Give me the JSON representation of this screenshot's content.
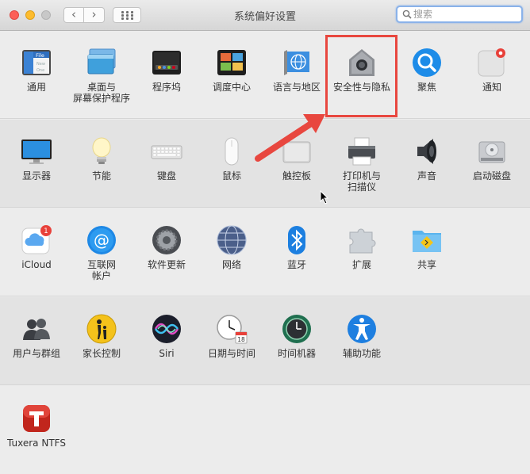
{
  "window": {
    "title": "系统偏好设置",
    "search_placeholder": "搜索"
  },
  "sections": [
    {
      "items": [
        {
          "id": "general",
          "label": "通用",
          "icon": "general-icon"
        },
        {
          "id": "desktop",
          "label": "桌面与\n屏幕保护程序",
          "icon": "desktop-screensaver-icon"
        },
        {
          "id": "dock",
          "label": "程序坞",
          "icon": "dock-icon"
        },
        {
          "id": "mission-control",
          "label": "调度中心",
          "icon": "mission-control-icon"
        },
        {
          "id": "language",
          "label": "语言与地区",
          "icon": "language-region-icon"
        },
        {
          "id": "security",
          "label": "安全性与隐私",
          "icon": "security-privacy-icon"
        },
        {
          "id": "spotlight",
          "label": "聚焦",
          "icon": "spotlight-icon"
        },
        {
          "id": "notifications",
          "label": "通知",
          "icon": "notifications-icon"
        }
      ]
    },
    {
      "items": [
        {
          "id": "displays",
          "label": "显示器",
          "icon": "displays-icon"
        },
        {
          "id": "energy",
          "label": "节能",
          "icon": "energy-saver-icon"
        },
        {
          "id": "keyboard",
          "label": "键盘",
          "icon": "keyboard-icon"
        },
        {
          "id": "mouse",
          "label": "鼠标",
          "icon": "mouse-icon"
        },
        {
          "id": "trackpad",
          "label": "触控板",
          "icon": "trackpad-icon"
        },
        {
          "id": "printers",
          "label": "打印机与\n扫描仪",
          "icon": "printer-icon"
        },
        {
          "id": "sound",
          "label": "声音",
          "icon": "sound-icon"
        },
        {
          "id": "startup-disk",
          "label": "启动磁盘",
          "icon": "startup-disk-icon"
        }
      ]
    },
    {
      "items": [
        {
          "id": "icloud",
          "label": "iCloud",
          "icon": "icloud-icon",
          "badge": "1"
        },
        {
          "id": "internet-accounts",
          "label": "互联网\n帐户",
          "icon": "internet-accounts-icon"
        },
        {
          "id": "software-update",
          "label": "软件更新",
          "icon": "software-update-icon"
        },
        {
          "id": "network",
          "label": "网络",
          "icon": "network-icon"
        },
        {
          "id": "bluetooth",
          "label": "蓝牙",
          "icon": "bluetooth-icon"
        },
        {
          "id": "extensions",
          "label": "扩展",
          "icon": "extensions-icon"
        },
        {
          "id": "sharing",
          "label": "共享",
          "icon": "sharing-icon"
        }
      ]
    },
    {
      "items": [
        {
          "id": "users",
          "label": "用户与群组",
          "icon": "users-groups-icon"
        },
        {
          "id": "parental",
          "label": "家长控制",
          "icon": "parental-controls-icon"
        },
        {
          "id": "siri",
          "label": "Siri",
          "icon": "siri-icon"
        },
        {
          "id": "date-time",
          "label": "日期与时间",
          "icon": "date-time-icon",
          "calendar_day": "18"
        },
        {
          "id": "time-machine",
          "label": "时间机器",
          "icon": "time-machine-icon"
        },
        {
          "id": "accessibility",
          "label": "辅助功能",
          "icon": "accessibility-icon"
        }
      ]
    },
    {
      "items": [
        {
          "id": "tuxera",
          "label": "Tuxera NTFS",
          "icon": "tuxera-ntfs-icon"
        }
      ]
    }
  ],
  "icon_text": {
    "general_doc_lines": [
      "File",
      "New",
      "One"
    ]
  },
  "annotation": {
    "highlight_color": "#e8473f",
    "highlighted_item": "security"
  }
}
